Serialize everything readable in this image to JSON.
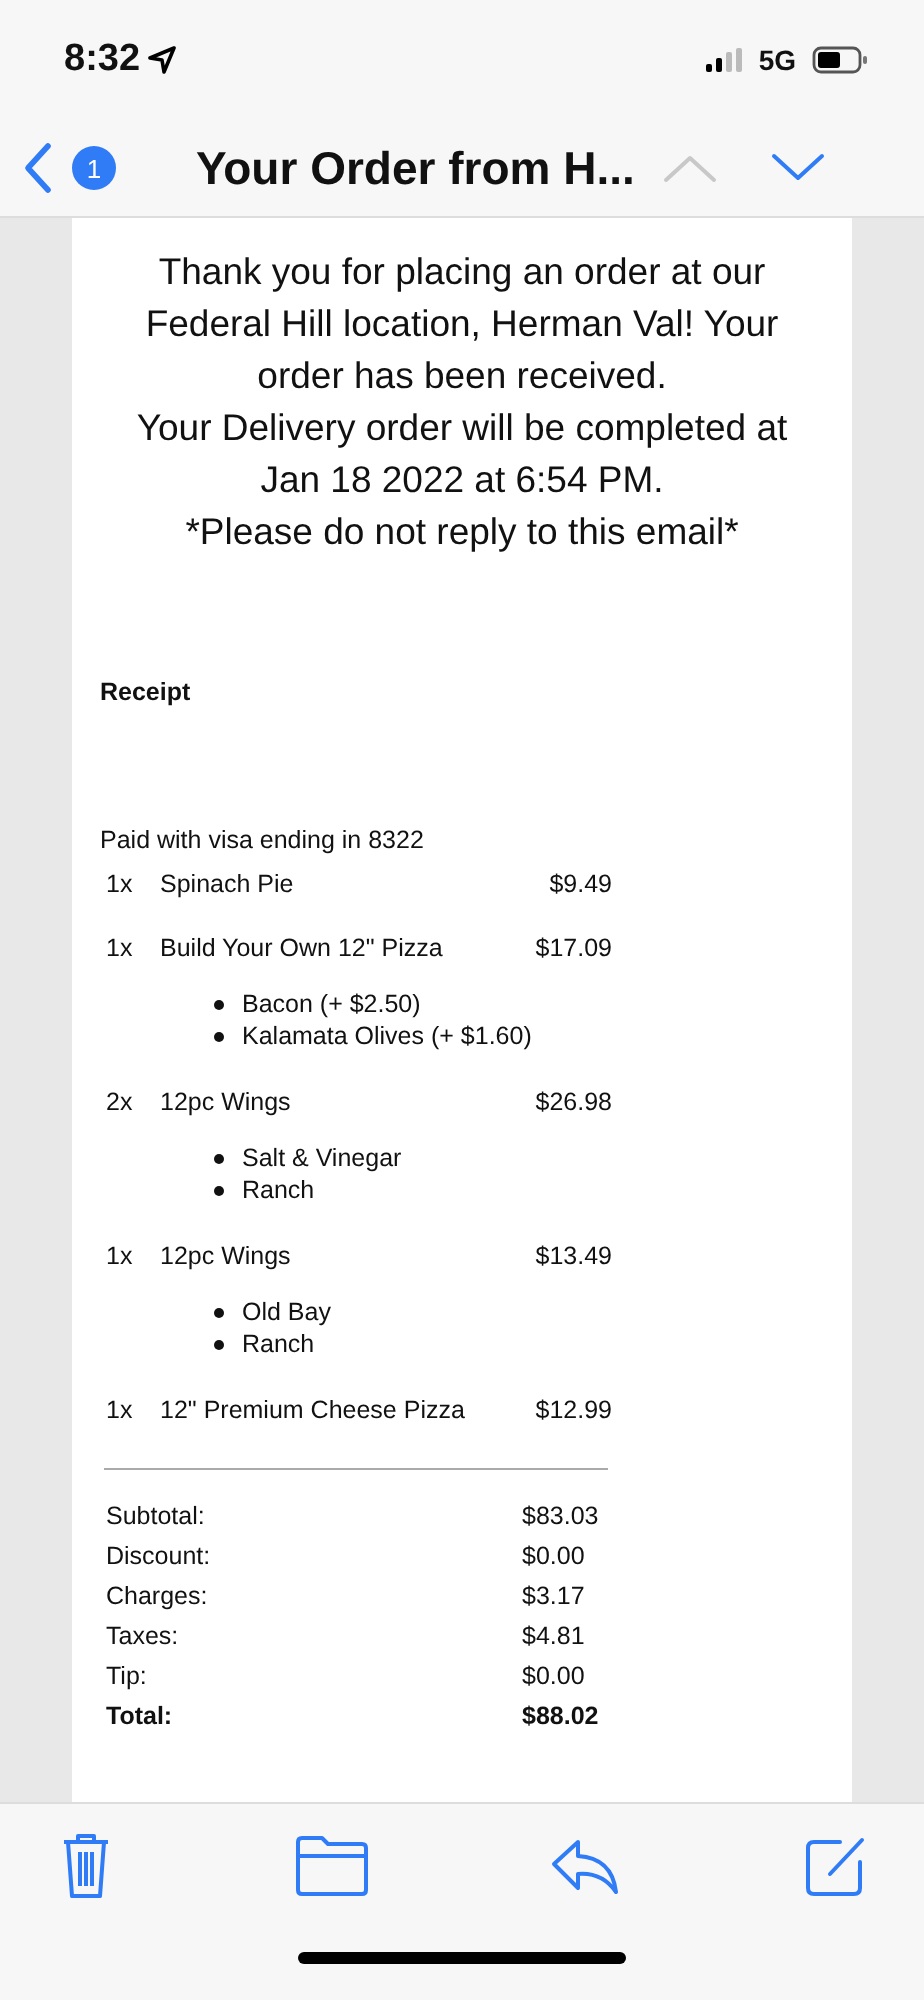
{
  "status_bar": {
    "time": "8:32",
    "network": "5G"
  },
  "nav": {
    "unread_count": "1",
    "title": "Your Order from H...",
    "previous_disabled": true,
    "next_disabled": false
  },
  "message": {
    "paragraphs": [
      "Thank you for placing an order at our Federal Hill location, Herman Val! Your order has been received.",
      "Your Delivery order will be completed at Jan 18 2022 at 6:54 PM.",
      "*Please do not reply to this email*"
    ],
    "receipt_heading": "Receipt",
    "payment": "Paid with visa ending in 8322",
    "items": [
      {
        "qty": "1x",
        "name": "Spinach Pie",
        "price": "$9.49"
      },
      {
        "qty": "1x",
        "name": "Build Your Own 12\" Pizza",
        "price": "$17.09",
        "options": [
          "Bacon (+ $2.50)",
          "Kalamata Olives (+ $1.60)"
        ]
      },
      {
        "qty": "2x",
        "name": "12pc Wings",
        "price": "$26.98",
        "options": [
          "Salt & Vinegar",
          "Ranch"
        ]
      },
      {
        "qty": "1x",
        "name": "12pc Wings",
        "price": "$13.49",
        "options": [
          "Old Bay",
          "Ranch"
        ]
      },
      {
        "qty": "1x",
        "name": "12\" Premium Cheese Pizza",
        "price": "$12.99"
      }
    ],
    "totals": [
      {
        "label": "Subtotal:",
        "value": "$83.03",
        "bold": false
      },
      {
        "label": "Discount:",
        "value": "$0.00",
        "bold": false
      },
      {
        "label": "Charges:",
        "value": "$3.17",
        "bold": false
      },
      {
        "label": "Taxes:",
        "value": "$4.81",
        "bold": false
      },
      {
        "label": "Tip:",
        "value": "$0.00",
        "bold": false
      },
      {
        "label": "Total:",
        "value": "$88.02",
        "bold": true
      }
    ]
  }
}
